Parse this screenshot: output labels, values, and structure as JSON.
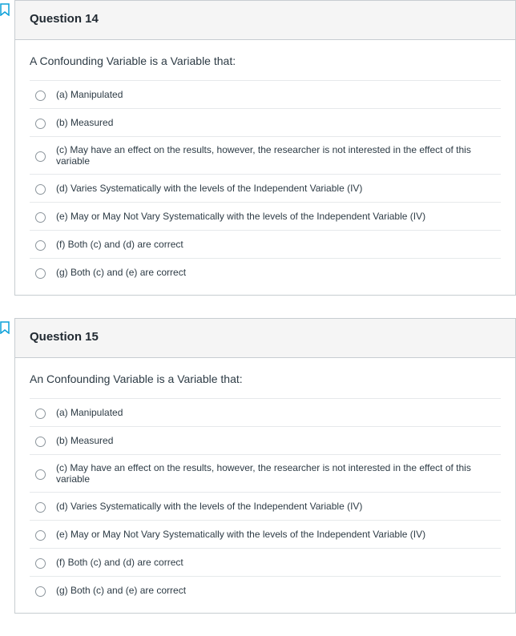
{
  "questions": [
    {
      "title": "Question 14",
      "prompt": "A Confounding Variable is a Variable that:",
      "options": [
        "(a) Manipulated",
        "(b) Measured",
        "(c) May have an effect on the results, however, the researcher is not interested in the effect of this variable",
        "(d) Varies Systematically with the levels of the Independent Variable (IV)",
        "(e) May or May Not Vary Systematically with the levels of the Independent Variable (IV)",
        "(f) Both (c) and (d) are correct",
        "(g) Both (c) and (e) are correct"
      ]
    },
    {
      "title": "Question 15",
      "prompt": "An Confounding Variable is a Variable that:",
      "options": [
        "(a) Manipulated",
        "(b) Measured",
        "(c) May have an effect on the results, however, the researcher is not interested in the effect of this variable",
        "(d) Varies Systematically with the levels of the Independent Variable (IV)",
        "(e) May or May Not Vary Systematically with the levels of the Independent Variable (IV)",
        "(f) Both (c) and (d) are correct",
        "(g) Both (c) and (e) are correct"
      ]
    }
  ]
}
